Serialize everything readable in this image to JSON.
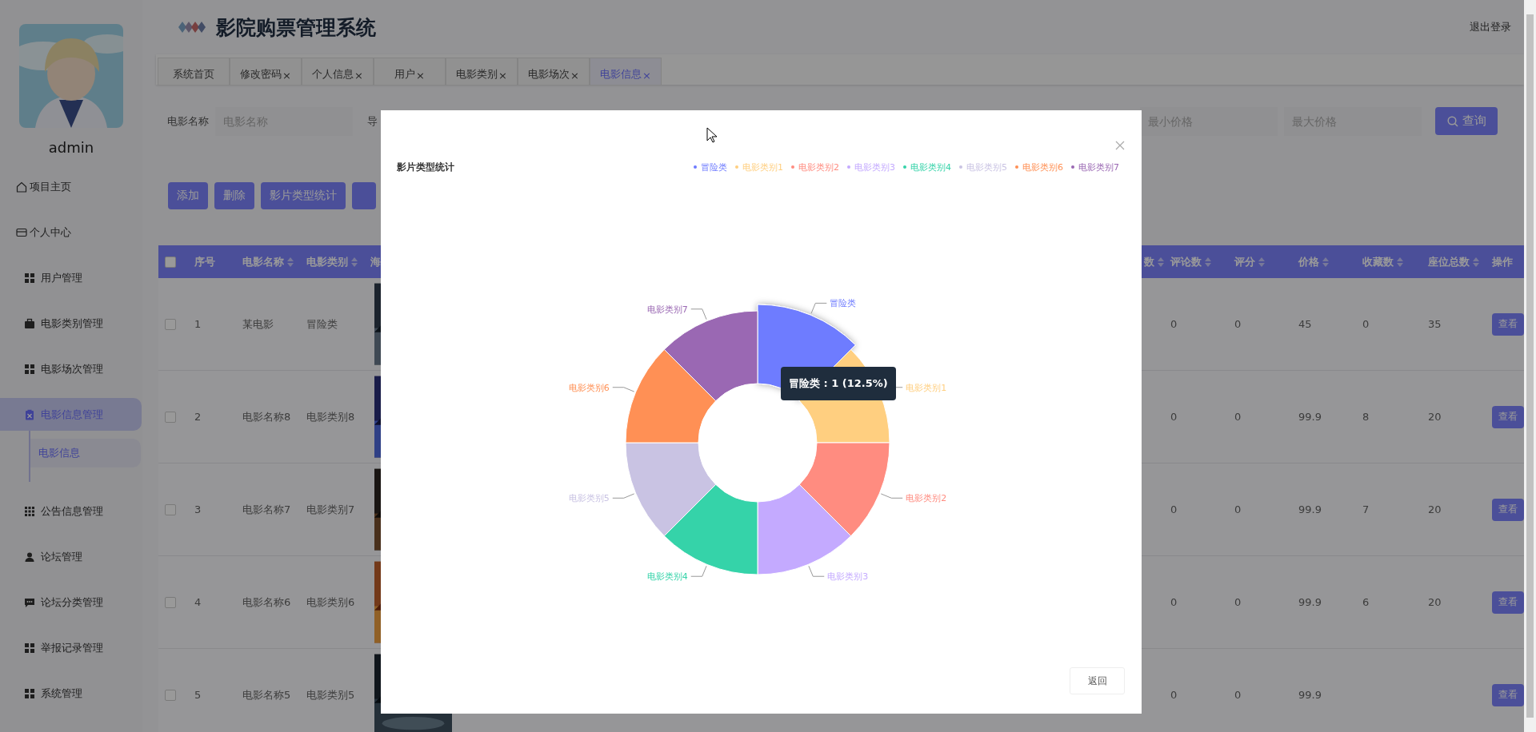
{
  "sidebar": {
    "username": "admin",
    "items": [
      {
        "label": "项目主页",
        "kind": "plain",
        "selected": false
      },
      {
        "label": "个人中心",
        "kind": "plain",
        "selected": false
      },
      {
        "label": "用户管理",
        "kind": "group",
        "selected": false
      },
      {
        "label": "电影类别管理",
        "kind": "group",
        "selected": false
      },
      {
        "label": "电影场次管理",
        "kind": "group",
        "selected": false
      },
      {
        "label": "电影信息管理",
        "kind": "group",
        "selected": true,
        "children": [
          {
            "label": "电影信息",
            "selected": true
          }
        ]
      },
      {
        "label": "公告信息管理",
        "kind": "group",
        "selected": false
      },
      {
        "label": "论坛管理",
        "kind": "group",
        "selected": false
      },
      {
        "label": "论坛分类管理",
        "kind": "group",
        "selected": false
      },
      {
        "label": "举报记录管理",
        "kind": "group",
        "selected": false
      },
      {
        "label": "系统管理",
        "kind": "group",
        "selected": false
      }
    ]
  },
  "header": {
    "title": "影院购票管理系统",
    "logout": "退出登录"
  },
  "tabs": [
    {
      "label": "系统首页",
      "selected": false
    },
    {
      "label": "修改密码",
      "close": "×",
      "selected": false
    },
    {
      "label": "个人信息",
      "close": "×",
      "selected": false
    },
    {
      "label": "用户",
      "close": "×",
      "selected": false
    },
    {
      "label": "电影类别",
      "close": "×",
      "selected": false
    },
    {
      "label": "电影场次",
      "close": "×",
      "selected": false
    },
    {
      "label": "电影信息",
      "close": "×",
      "selected": true
    }
  ],
  "filters": {
    "left": [
      {
        "label": "电影名称",
        "placeholder": "电影名称"
      },
      {
        "label": "导"
      }
    ],
    "right": [
      {
        "placeholder": "最小价格"
      },
      {
        "placeholder": "最大价格"
      }
    ],
    "search_button": "查询"
  },
  "actions": [
    {
      "kind": "button",
      "label": "添加"
    },
    {
      "kind": "button",
      "label": "删除"
    },
    {
      "kind": "button",
      "label": "影片类型统计"
    },
    {
      "kind": "covered"
    }
  ],
  "table": {
    "header_checked": false,
    "columns_left": [
      {
        "label": "序号",
        "kind": "plain"
      },
      {
        "label": "电影名称",
        "kind": "sortable"
      },
      {
        "label": "电影类别",
        "kind": "sortable"
      },
      {
        "label": "海",
        "kind": "plain"
      }
    ],
    "columns_right": [
      {
        "label": "数",
        "kind": "sortable"
      },
      {
        "label": "评论数",
        "kind": "sortable"
      },
      {
        "label": "评分",
        "kind": "sortable"
      },
      {
        "label": "价格",
        "kind": "sortable"
      },
      {
        "label": "收藏数",
        "kind": "sortable"
      },
      {
        "label": "座位总数",
        "kind": "sortable"
      },
      {
        "label": "操作",
        "kind": "plain"
      }
    ],
    "rows": [
      {
        "checked": false,
        "index": "1",
        "name": "某电影",
        "category": "冒险类",
        "comments": "0",
        "rating": "0",
        "price": "45",
        "favorites": "0",
        "seats": "35",
        "action": "查看"
      },
      {
        "checked": false,
        "index": "2",
        "name": "电影名称8",
        "category": "电影类别8",
        "comments": "0",
        "rating": "0",
        "price": "99.9",
        "favorites": "8",
        "seats": "20",
        "action": "查看"
      },
      {
        "checked": false,
        "index": "3",
        "name": "电影名称7",
        "category": "电影类别7",
        "comments": "0",
        "rating": "0",
        "price": "99.9",
        "favorites": "7",
        "seats": "20",
        "action": "查看"
      },
      {
        "checked": false,
        "index": "4",
        "name": "电影名称6",
        "category": "电影类别6",
        "comments": "0",
        "rating": "0",
        "price": "99.9",
        "favorites": "6",
        "seats": "20",
        "action": "查看"
      },
      {
        "checked": false,
        "index": "5",
        "name": "电影名称5",
        "category": "电影类别5",
        "comments": "0",
        "rating": "0",
        "price": "99.9",
        "action": "查看"
      }
    ]
  },
  "modal": {
    "title": "影片类型统计",
    "legend": [
      {
        "label": "冒险类",
        "color": "#6e7bff"
      },
      {
        "label": "电影类别1",
        "color": "#ffcf80"
      },
      {
        "label": "电影类别2",
        "color": "#ff8c80"
      },
      {
        "label": "电影类别3",
        "color": "#c4aaff"
      },
      {
        "label": "电影类别4",
        "color": "#35d3a9"
      },
      {
        "label": "电影类别5",
        "color": "#c9c3e3"
      },
      {
        "label": "电影类别6",
        "color": "#ff9055"
      },
      {
        "label": "电影类别7",
        "color": "#9a68b3"
      }
    ],
    "chart_data": {
      "type": "donut",
      "categories": [
        "冒险类",
        "电影类别1",
        "电影类别2",
        "电影类别3",
        "电影类别4",
        "电影类别5",
        "电影类别6",
        "电影类别7"
      ],
      "series": [
        {
          "values": [
            1,
            1,
            1,
            1,
            1,
            1,
            1,
            1
          ]
        }
      ]
    },
    "slices": [
      {
        "highlighted": true
      },
      {
        "highlighted": false
      },
      {
        "highlighted": false
      },
      {
        "highlighted": false
      },
      {
        "highlighted": false
      },
      {
        "highlighted": false
      },
      {
        "highlighted": false
      },
      {
        "highlighted": false
      }
    ],
    "tooltip": "冒险类 : 1 (12.5%)",
    "footer_button": "返回"
  }
}
